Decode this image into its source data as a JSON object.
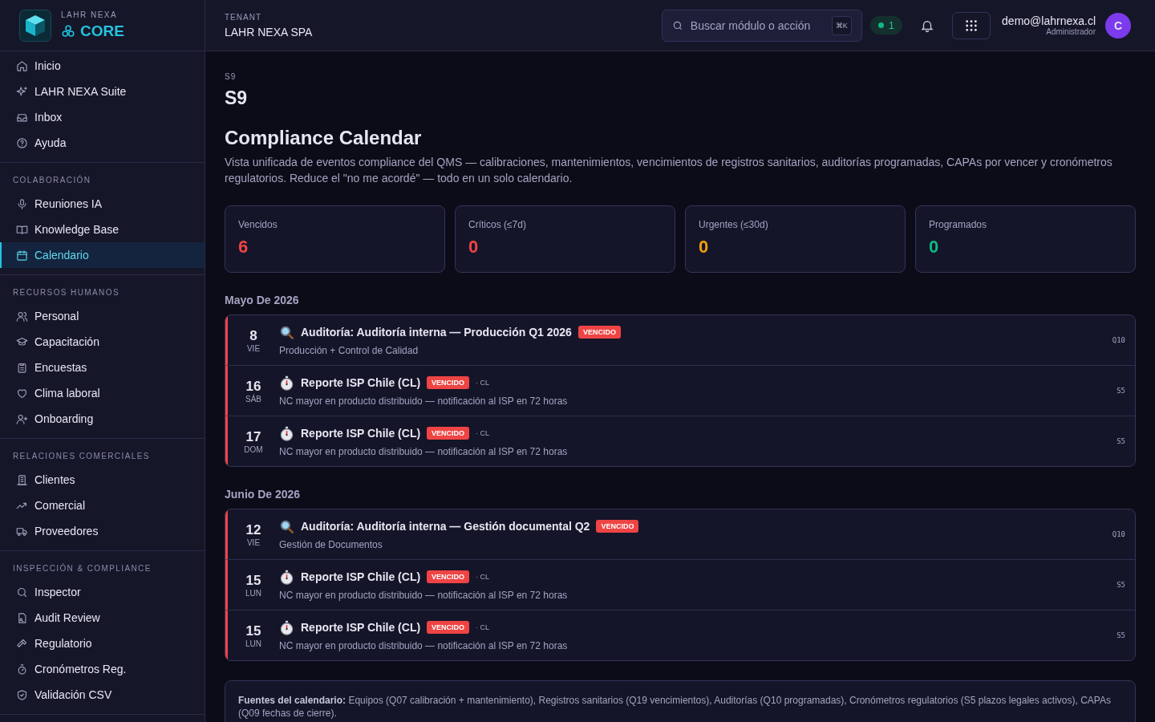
{
  "brand": {
    "company": "LAHR NEXA",
    "product": "CORE"
  },
  "sidebar": {
    "sections": [
      {
        "items": [
          {
            "label": "Inicio",
            "selected": false
          },
          {
            "label": "LAHR NEXA Suite",
            "selected": false
          },
          {
            "label": "Inbox",
            "selected": false
          },
          {
            "label": "Ayuda",
            "selected": false
          }
        ]
      },
      {
        "heading": "COLABORACIÓN",
        "items": [
          {
            "label": "Reuniones IA",
            "selected": false
          },
          {
            "label": "Knowledge Base",
            "selected": false
          },
          {
            "label": "Calendario",
            "selected": true
          }
        ]
      },
      {
        "heading": "RECURSOS HUMANOS",
        "items": [
          {
            "label": "Personal",
            "selected": false
          },
          {
            "label": "Capacitación",
            "selected": false
          },
          {
            "label": "Encuestas",
            "selected": false
          },
          {
            "label": "Clima laboral",
            "selected": false
          },
          {
            "label": "Onboarding",
            "selected": false
          }
        ]
      },
      {
        "heading": "RELACIONES COMERCIALES",
        "items": [
          {
            "label": "Clientes",
            "selected": false
          },
          {
            "label": "Comercial",
            "selected": false
          },
          {
            "label": "Proveedores",
            "selected": false
          }
        ]
      },
      {
        "heading": "INSPECCIÓN & COMPLIANCE",
        "items": [
          {
            "label": "Inspector",
            "selected": false
          },
          {
            "label": "Audit Review",
            "selected": false
          },
          {
            "label": "Regulatorio",
            "selected": false
          },
          {
            "label": "Cronómetros Reg.",
            "selected": false
          },
          {
            "label": "Validación CSV",
            "selected": false
          }
        ]
      }
    ]
  },
  "topbar": {
    "tenant_label": "TENANT",
    "tenant": "LAHR NEXA SPA",
    "search": {
      "placeholder": "Buscar módulo o acción",
      "shortcut": "⌘K"
    },
    "status_count": "1",
    "user": {
      "email": "demo@lahrnexa.cl",
      "role": "Administrador",
      "initial": "C"
    }
  },
  "page": {
    "code_small": "S9",
    "code": "S9",
    "title": "Compliance Calendar",
    "description": "Vista unificada de eventos compliance del QMS — calibraciones, mantenimientos, vencimientos de registros sanitarios, auditorías programadas, CAPAs por vencer y cronómetros regulatorios. Reduce el \"no me acordé\" — todo en un solo calendario."
  },
  "stats": [
    {
      "label": "Vencidos",
      "value": "6",
      "color": "#ef4444"
    },
    {
      "label": "Críticos (≤7d)",
      "value": "0",
      "color": "#ef4444"
    },
    {
      "label": "Urgentes (≤30d)",
      "value": "0",
      "color": "#f59e0b"
    },
    {
      "label": "Programados",
      "value": "0",
      "color": "#10b981"
    }
  ],
  "months": [
    {
      "title": "Mayo De 2026",
      "events": [
        {
          "kind": "audit",
          "day": "8",
          "weekday": "VIE",
          "title": "Auditoría: Auditoría interna — Producción Q1 2026",
          "badge": "VENCIDO",
          "overdue": true,
          "subtitle": "Producción + Control de Calidad",
          "code": "Q10"
        },
        {
          "kind": "timer",
          "day": "16",
          "weekday": "SÁB",
          "title": "Reporte ISP Chile (CL)",
          "badge": "VENCIDO",
          "overdue": true,
          "tag": "· CL",
          "subtitle": "NC mayor en producto distribuido — notificación al ISP en 72 horas",
          "code": "S5"
        },
        {
          "kind": "timer",
          "day": "17",
          "weekday": "DOM",
          "title": "Reporte ISP Chile (CL)",
          "badge": "VENCIDO",
          "overdue": true,
          "tag": "· CL",
          "subtitle": "NC mayor en producto distribuido — notificación al ISP en 72 horas",
          "code": "S5"
        }
      ]
    },
    {
      "title": "Junio De 2026",
      "events": [
        {
          "kind": "audit",
          "day": "12",
          "weekday": "VIE",
          "title": "Auditoría: Auditoría interna — Gestión documental Q2",
          "badge": "VENCIDO",
          "overdue": true,
          "subtitle": "Gestión de Documentos",
          "code": "Q10"
        },
        {
          "kind": "timer",
          "day": "15",
          "weekday": "LUN",
          "title": "Reporte ISP Chile (CL)",
          "badge": "VENCIDO",
          "overdue": true,
          "tag": "· CL",
          "subtitle": "NC mayor en producto distribuido — notificación al ISP en 72 horas",
          "code": "S5"
        },
        {
          "kind": "timer",
          "day": "15",
          "weekday": "LUN",
          "title": "Reporte ISP Chile (CL)",
          "badge": "VENCIDO",
          "overdue": true,
          "tag": "· CL",
          "subtitle": "NC mayor en producto distribuido — notificación al ISP en 72 horas",
          "code": "S5"
        }
      ]
    }
  ],
  "sources_note": "**Fuentes del calendario:** Equipos (Q07 calibración + mantenimiento), Registros sanitarios (Q19 vencimientos), Auditorías (Q10 programadas), Cronómetros regulatorios (S5 plazos legales activos), CAPAs (Q09 fechas de cierre)."
}
